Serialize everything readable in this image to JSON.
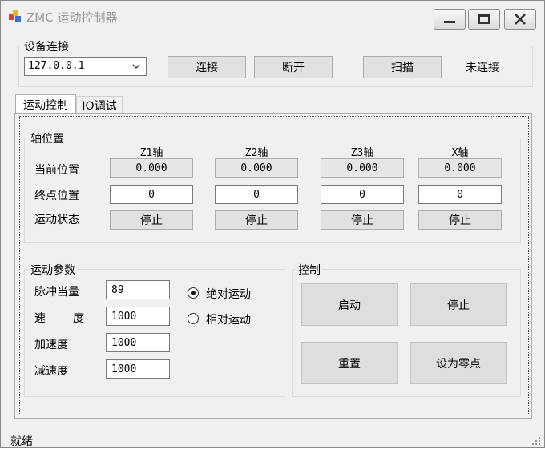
{
  "window": {
    "title": "ZMC 运动控制器"
  },
  "device": {
    "group_label": "设备连接",
    "ip_value": "127.0.0.1",
    "connect_label": "连接",
    "disconnect_label": "断开",
    "scan_label": "扫描",
    "connection_status": "未连接"
  },
  "tabs": [
    {
      "label": "运动控制",
      "active": true
    },
    {
      "label": "IO调试",
      "active": false
    }
  ],
  "axis_panel": {
    "group_label": "轴位置",
    "row_labels": {
      "current": "当前位置",
      "target": "终点位置",
      "state": "运动状态"
    },
    "axes": [
      {
        "name": "Z1轴",
        "current": "0.000",
        "target": "0",
        "state": "停止"
      },
      {
        "name": "Z2轴",
        "current": "0.000",
        "target": "0",
        "state": "停止"
      },
      {
        "name": "Z3轴",
        "current": "0.000",
        "target": "0",
        "state": "停止"
      },
      {
        "name": "X轴",
        "current": "0.000",
        "target": "0",
        "state": "停止"
      }
    ]
  },
  "motion_params": {
    "group_label": "运动参数",
    "pulse_label": "脉冲当量",
    "pulse_value": "89",
    "speed_label_a": "速",
    "speed_label_b": "度",
    "speed_value": "1000",
    "accel_label": "加速度",
    "accel_value": "1000",
    "decel_label": "减速度",
    "decel_value": "1000",
    "mode_absolute": "绝对运动",
    "mode_relative": "相对运动",
    "selected_mode": "absolute"
  },
  "control": {
    "group_label": "控制",
    "start_label": "启动",
    "stop_label": "停止",
    "reset_label": "重置",
    "set_zero_label": "设为零点"
  },
  "statusbar": {
    "text": "就绪"
  }
}
